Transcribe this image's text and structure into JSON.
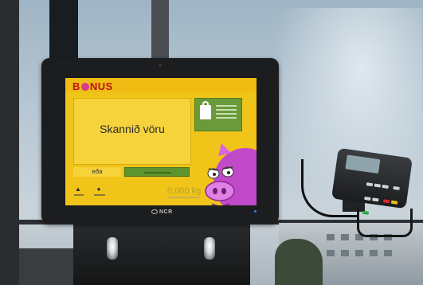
{
  "screen": {
    "logo": {
      "before": "B",
      "after": "NUS"
    },
    "prompt": "Skannið vöru",
    "or_label": "eða",
    "weight": "0,000 kg"
  },
  "device": {
    "brand": "NCR"
  },
  "colors": {
    "screen_yellow": "#f0c419",
    "logo_red": "#c0121a",
    "button_green": "#5e9430",
    "pig_pink": "#c04ac8",
    "status_led": "#3b7bff"
  },
  "icons": [
    "shopping-bag-icon",
    "help-icon",
    "language-icon",
    "piggy-bank-mascot",
    "card-payment-terminal"
  ]
}
